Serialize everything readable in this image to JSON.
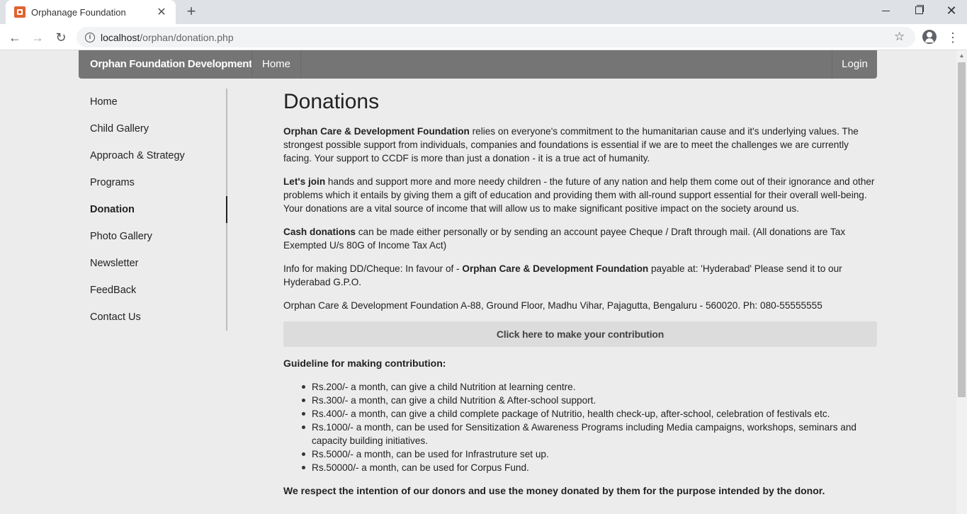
{
  "browser": {
    "tab_title": "Orphanage Foundation",
    "tab_close": "✕",
    "new_tab": "+",
    "url_host": "localhost",
    "url_path": "/orphan/donation.php"
  },
  "navbar": {
    "brand": "Orphan Foundation Development",
    "home": "Home",
    "login": "Login"
  },
  "sidebar": {
    "items": [
      {
        "label": "Home"
      },
      {
        "label": "Child Gallery"
      },
      {
        "label": "Approach & Strategy"
      },
      {
        "label": "Programs"
      },
      {
        "label": "Donation",
        "active": true
      },
      {
        "label": "Photo Gallery"
      },
      {
        "label": "Newsletter"
      },
      {
        "label": "FeedBack"
      },
      {
        "label": "Contact Us"
      }
    ]
  },
  "main": {
    "title": "Donations",
    "p1_bold": "Orphan Care & Development Foundation",
    "p1_text": " relies on everyone's commitment to the humanitarian cause and it's underlying values. The strongest possible support from individuals, companies and foundations is essential if we are to meet the challenges we are currently facing. Your support to CCDF is more than just a donation - it is a true act of humanity.",
    "p2_bold": "Let's join",
    "p2_text": " hands and support more and more needy children - the future of any nation and help them come out of their ignorance and other problems which it entails by giving them a gift of education and providing them with all-round support essential for their overall well-being. Your donations are a vital source of income that will allow us to make significant positive impact on the society around us.",
    "p3_bold": "Cash donations",
    "p3_text": " can be made either personally or by sending an account payee Cheque / Draft through mail. (All donations are Tax Exempted U/s 80G of Income Tax Act)",
    "p4_pre": "Info for making DD/Cheque: In favour of - ",
    "p4_bold": "Orphan Care & Development Foundation",
    "p4_post": " payable at: 'Hyderabad' Please send it to our Hyderabad G.P.O.",
    "p5_text": "Orphan Care & Development Foundation A-88, Ground Floor, Madhu Vihar, Pajagutta, Bengaluru - 560020. Ph: 080-55555555",
    "contribute_button": "Click here to make your contribution",
    "guideline_title": "Guideline for making contribution:",
    "guidelines": [
      "Rs.200/- a month, can give a child Nutrition at learning centre.",
      "Rs.300/- a month, can give a child Nutrition & After-school support.",
      "Rs.400/- a month, can give a child complete package of Nutritio, health check-up, after-school, celebration of festivals etc.",
      "Rs.1000/- a month, can be used for Sensitization & Awareness Programs including Media campaigns, workshops, seminars and capacity building initiatives.",
      "Rs.5000/- a month, can be used for Infrastruture set up.",
      "Rs.50000/- a month, can be used for Corpus Fund."
    ],
    "respect_text": "We respect the intention of our donors and use the money donated by them for the purpose intended by the donor."
  }
}
